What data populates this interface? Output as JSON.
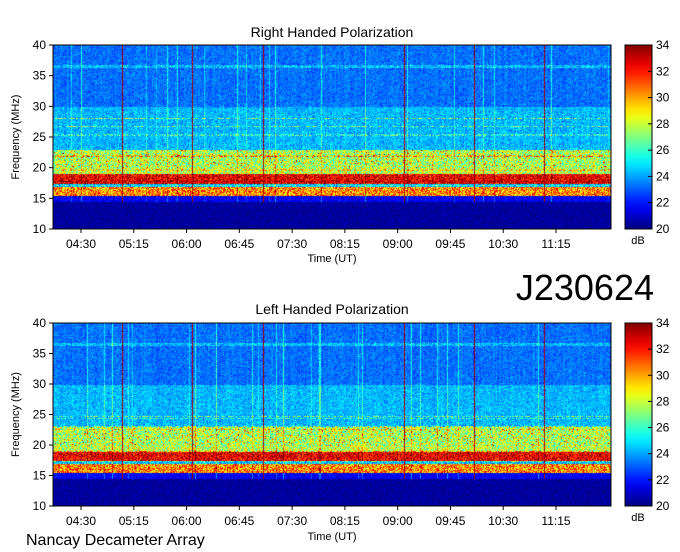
{
  "observation_id": "J230624",
  "instrument": "Nancay Decameter Array",
  "chart_data": [
    {
      "type": "heatmap",
      "title": "Right Handed Polarization",
      "xlabel": "Time (UT)",
      "ylabel": "Frequency (MHz)",
      "x_ticks": [
        "04:30",
        "05:15",
        "06:00",
        "06:45",
        "07:30",
        "08:15",
        "09:00",
        "09:45",
        "10:30",
        "11:15"
      ],
      "y_ticks": [
        10,
        15,
        20,
        25,
        30,
        35,
        40
      ],
      "ylim": [
        10,
        40
      ],
      "colorbar": {
        "label": "dB",
        "ticks": [
          20,
          22,
          24,
          26,
          28,
          30,
          32,
          34
        ],
        "range": [
          20,
          34
        ],
        "colormap": "jet"
      },
      "bright_bands_mhz": [
        [
          15.5,
          17.0
        ],
        [
          17.5,
          19.0
        ],
        [
          20.0,
          23.0
        ]
      ],
      "vertical_markers_ut": [
        "05:05",
        "06:05",
        "07:05",
        "09:05",
        "10:05",
        "11:05"
      ]
    },
    {
      "type": "heatmap",
      "title": "Left Handed Polarization",
      "xlabel": "Time (UT)",
      "ylabel": "Frequency (MHz)",
      "x_ticks": [
        "04:30",
        "05:15",
        "06:00",
        "06:45",
        "07:30",
        "08:15",
        "09:00",
        "09:45",
        "10:30",
        "11:15"
      ],
      "y_ticks": [
        10,
        15,
        20,
        25,
        30,
        35,
        40
      ],
      "ylim": [
        10,
        40
      ],
      "colorbar": {
        "label": "dB",
        "ticks": [
          20,
          22,
          24,
          26,
          28,
          30,
          32,
          34
        ],
        "range": [
          20,
          34
        ],
        "colormap": "jet"
      },
      "bright_bands_mhz": [
        [
          15.5,
          17.0
        ],
        [
          17.5,
          19.0
        ],
        [
          20.0,
          23.0
        ]
      ],
      "vertical_markers_ut": [
        "05:05",
        "06:05",
        "07:05",
        "09:05",
        "10:05",
        "11:05"
      ]
    }
  ]
}
